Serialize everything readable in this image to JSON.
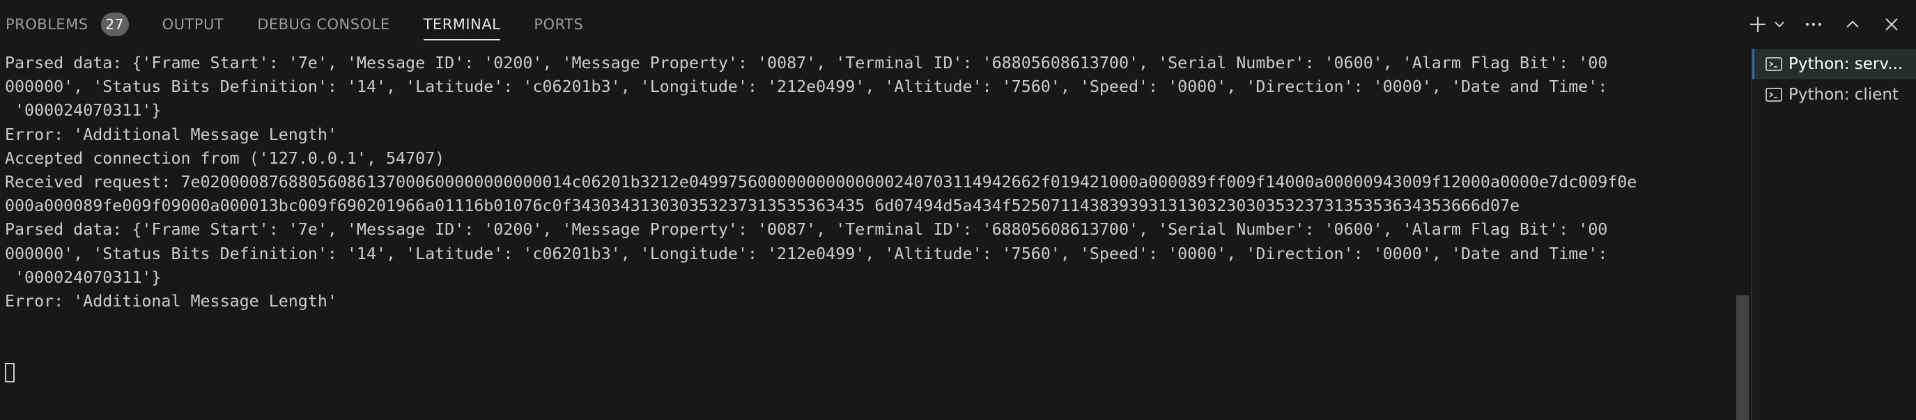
{
  "tabs": [
    {
      "label": "PROBLEMS",
      "badge": "27"
    },
    {
      "label": "OUTPUT"
    },
    {
      "label": "DEBUG CONSOLE"
    },
    {
      "label": "TERMINAL",
      "active": true
    },
    {
      "label": "PORTS"
    }
  ],
  "actions": [
    "plus-icon",
    "chevron-down-icon",
    "ellipsis-icon",
    "chevron-up-icon",
    "close-icon"
  ],
  "terminal": {
    "lines": [
      "Parsed data: {'Frame Start': '7e', 'Message ID': '0200', 'Message Property': '0087', 'Terminal ID': '68805608613700', 'Serial Number': '0600', 'Alarm Flag Bit': '00",
      "000000', 'Status Bits Definition': '14', 'Latitude': 'c06201b3', 'Longitude': '212e0499', 'Altitude': '7560', 'Speed': '0000', 'Direction': '0000', 'Date and Time':",
      " '000024070311'}",
      "Error: 'Additional Message Length'",
      "Accepted connection from ('127.0.0.1', 54707)",
      "Received request: 7e02000087688056086137000600000000000014c06201b3212e049975600000000000000240703114942662f019421000a000089ff009f14000a00000943009f12000a0000e7dc009f0e",
      "000a000089fe009f09000a000013bc009f690201966a01116b01076c0f343034313030353237313535363435 6d07494d5a434f525071143839393131303230303532373135353634353666d07e",
      "Parsed data: {'Frame Start': '7e', 'Message ID': '0200', 'Message Property': '0087', 'Terminal ID': '68805608613700', 'Serial Number': '0600', 'Alarm Flag Bit': '00",
      "000000', 'Status Bits Definition': '14', 'Latitude': 'c06201b3', 'Longitude': '212e0499', 'Altitude': '7560', 'Speed': '0000', 'Direction': '0000', 'Date and Time':",
      " '000024070311'}",
      "Error: 'Additional Message Length'"
    ]
  },
  "sessions": [
    {
      "label": "Python: serv...",
      "active": true
    },
    {
      "label": "Python: client",
      "active": false
    }
  ],
  "colors": {
    "background": "#181818",
    "text": "#cccccc",
    "accent": "#0078d4",
    "badge": "#616161"
  }
}
